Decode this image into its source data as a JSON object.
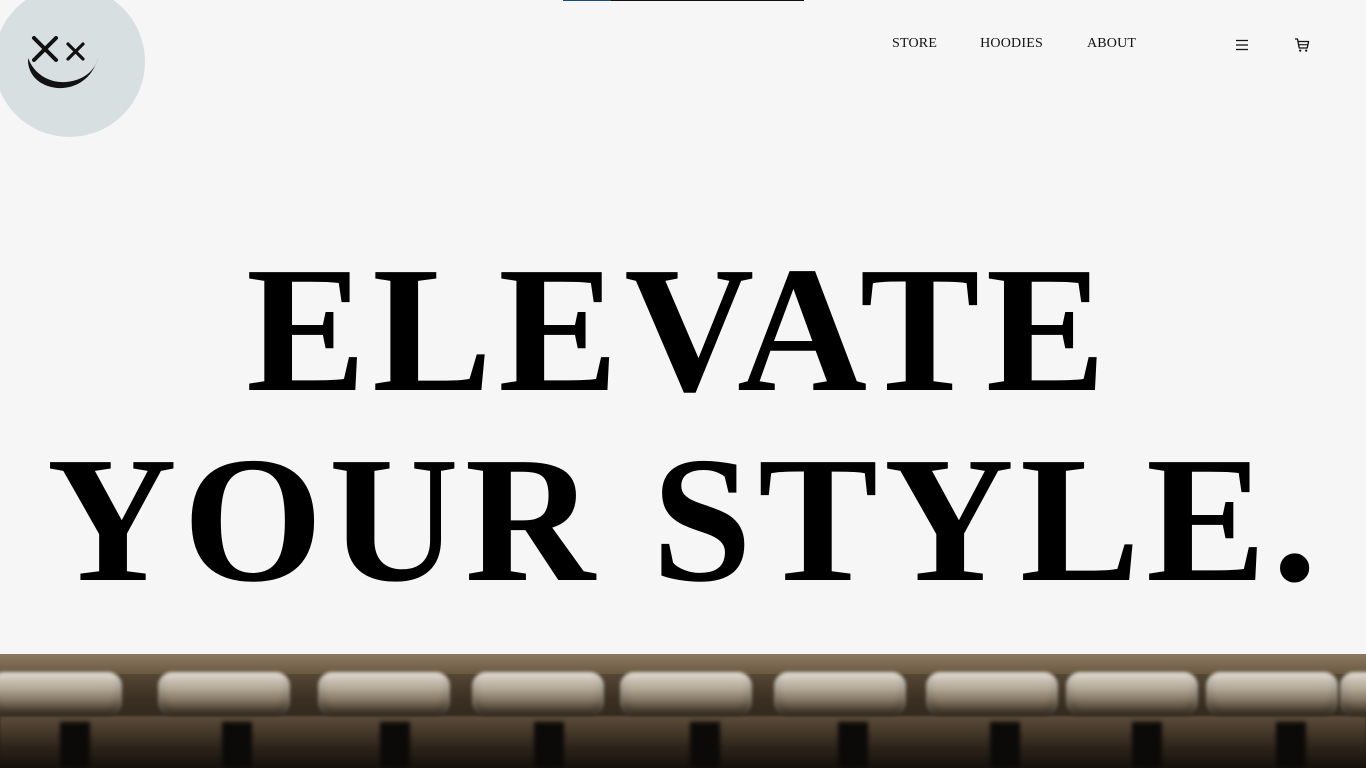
{
  "header": {
    "logo_icon": "smiley-x-eyes-icon",
    "nav": {
      "store": "STORE",
      "hoodies": "HOODIES",
      "about": "ABOUT"
    },
    "menu_icon": "hamburger-menu-icon",
    "cart_icon": "shopping-cart-icon"
  },
  "hero": {
    "line1": "ELEVATE",
    "line2": "YOUR STYLE."
  },
  "colors": {
    "background": "#f6f6f6",
    "logo_circle": "#d7dfe0",
    "text": "#000000"
  }
}
